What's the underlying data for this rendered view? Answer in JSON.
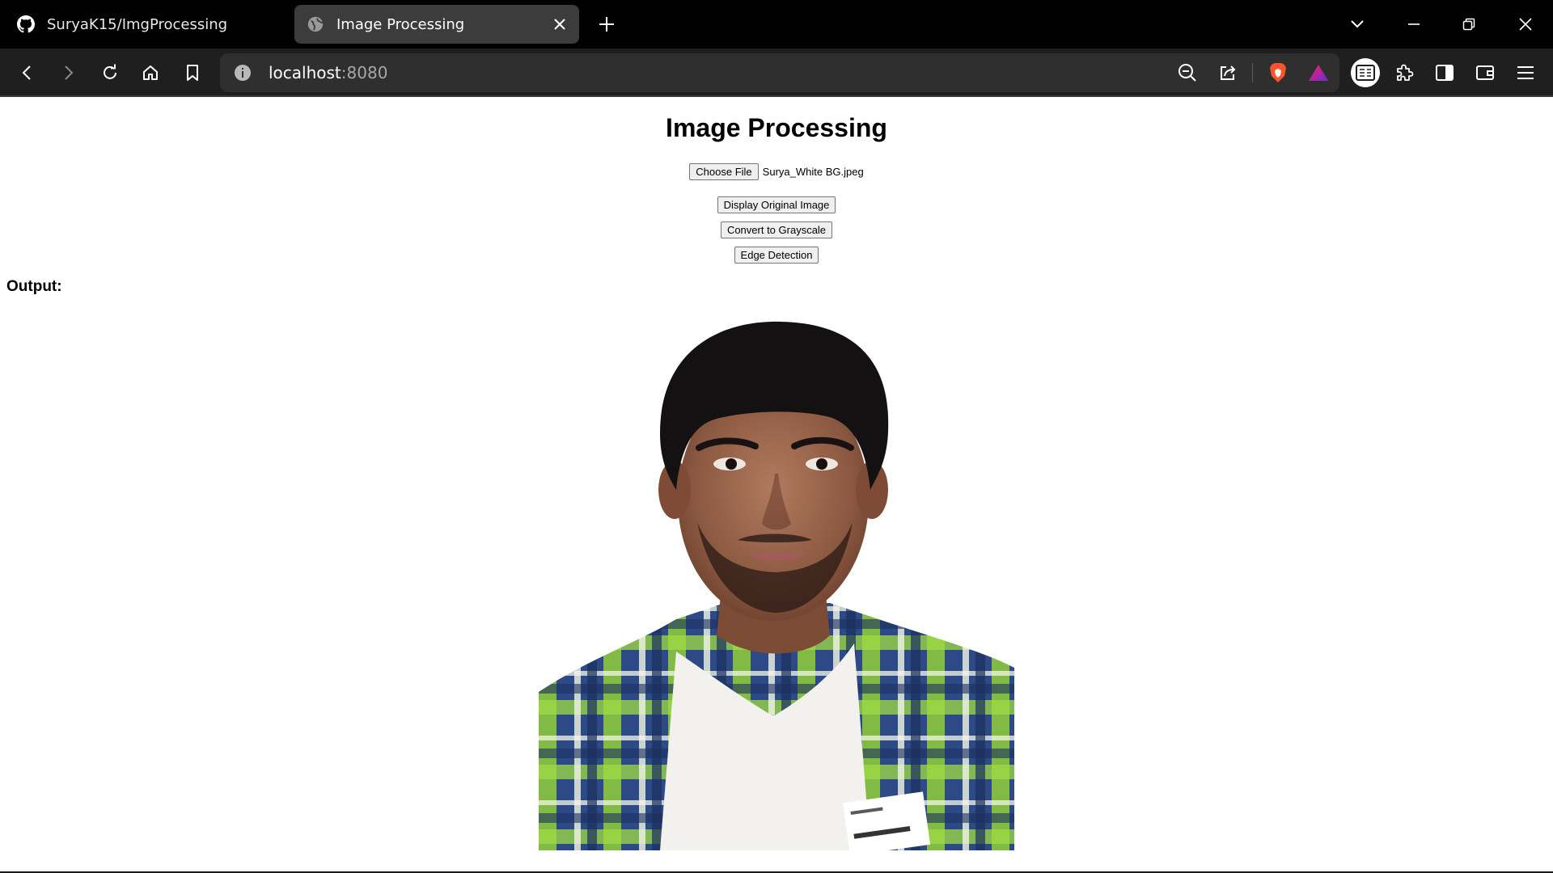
{
  "browser": {
    "tabs": [
      {
        "label": "SuryaK15/ImgProcessing",
        "icon": "github-icon",
        "active": false
      },
      {
        "label": "Image Processing",
        "icon": "globe-icon",
        "active": true
      }
    ],
    "url_host": "localhost",
    "url_port": ":8080"
  },
  "page": {
    "title": "Image Processing",
    "choose_file_label": "Choose File",
    "file_name": "Surya_White BG.jpeg",
    "buttons": {
      "display_original": "Display Original Image",
      "grayscale": "Convert to Grayscale",
      "edge_detection": "Edge Detection"
    },
    "output_label": "Output:",
    "output_image": "portrait photo of a smiling young man with dark hair wearing a plaid shirt over a white t-shirt and a visitor badge, on a white background"
  },
  "colors": {
    "tabstrip_bg": "#000000",
    "toolbar_bg": "#1f1f1f",
    "active_tab_bg": "#3c3c3c",
    "urlbar_bg": "#2f2f2f",
    "page_bg": "#ffffff",
    "brave_orange": "#fb542b"
  }
}
